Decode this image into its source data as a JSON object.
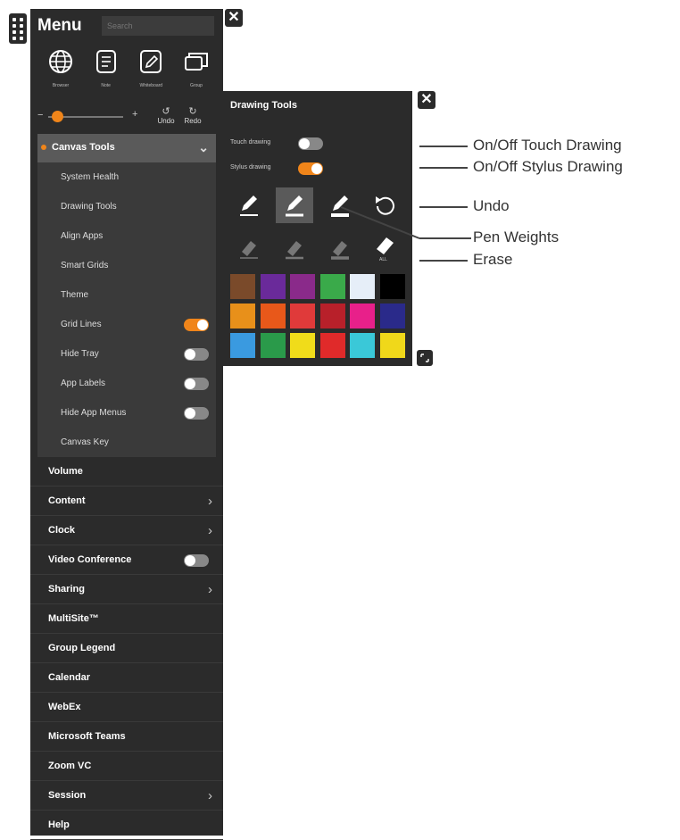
{
  "menu": {
    "title": "Menu",
    "search_placeholder": "Search",
    "apps": [
      {
        "label": "Browser",
        "icon": "globe-icon"
      },
      {
        "label": "Note",
        "icon": "note-icon"
      },
      {
        "label": "Whiteboard",
        "icon": "whiteboard-icon"
      },
      {
        "label": "Group",
        "icon": "group-icon"
      }
    ],
    "undo_label": "Undo",
    "redo_label": "Redo",
    "zoom_level": 0.05,
    "canvas_tools": {
      "label": "Canvas Tools",
      "items": [
        {
          "label": "System Health"
        },
        {
          "label": "Drawing Tools"
        },
        {
          "label": "Align Apps"
        },
        {
          "label": "Smart Grids"
        },
        {
          "label": "Theme"
        },
        {
          "label": "Grid Lines",
          "toggle": true,
          "on": true
        },
        {
          "label": "Hide Tray",
          "toggle": true,
          "on": false
        },
        {
          "label": "App Labels",
          "toggle": true,
          "on": false
        },
        {
          "label": "Hide App Menus",
          "toggle": true,
          "on": false
        },
        {
          "label": "Canvas Key"
        }
      ]
    },
    "items": [
      {
        "label": "Volume"
      },
      {
        "label": "Content",
        "chevron": true
      },
      {
        "label": "Clock",
        "chevron": true
      },
      {
        "label": "Video Conference",
        "toggle": true,
        "on": false
      },
      {
        "label": "Sharing",
        "chevron": true
      },
      {
        "label": "MultiSite™"
      },
      {
        "label": "Group Legend"
      },
      {
        "label": "Calendar"
      },
      {
        "label": "WebEx"
      },
      {
        "label": "Microsoft Teams"
      },
      {
        "label": "Zoom VC"
      },
      {
        "label": "Session",
        "chevron": true
      },
      {
        "label": "Help"
      }
    ]
  },
  "drawing_tools": {
    "title": "Drawing Tools",
    "touch_label": "Touch drawing",
    "touch_on": false,
    "stylus_label": "Stylus drawing",
    "stylus_on": true,
    "eraser_label": "ALL",
    "colors": [
      "#7a4a2a",
      "#6a2a9a",
      "#8a2a8a",
      "#3aaa4a",
      "#e6eef8",
      "#000000",
      "#e8901a",
      "#e8581a",
      "#e03a3a",
      "#b8202a",
      "#e8208a",
      "#2a2a8a",
      "#3a9ae0",
      "#2a9a4a",
      "#f0dc1a",
      "#e02a2a",
      "#3ac8d8",
      "#f0d81a"
    ]
  },
  "callouts": [
    "On/Off Touch Drawing",
    "On/Off Stylus Drawing",
    "Undo",
    "Pen Weights",
    "Erase"
  ],
  "accent_color": "#f0851a"
}
